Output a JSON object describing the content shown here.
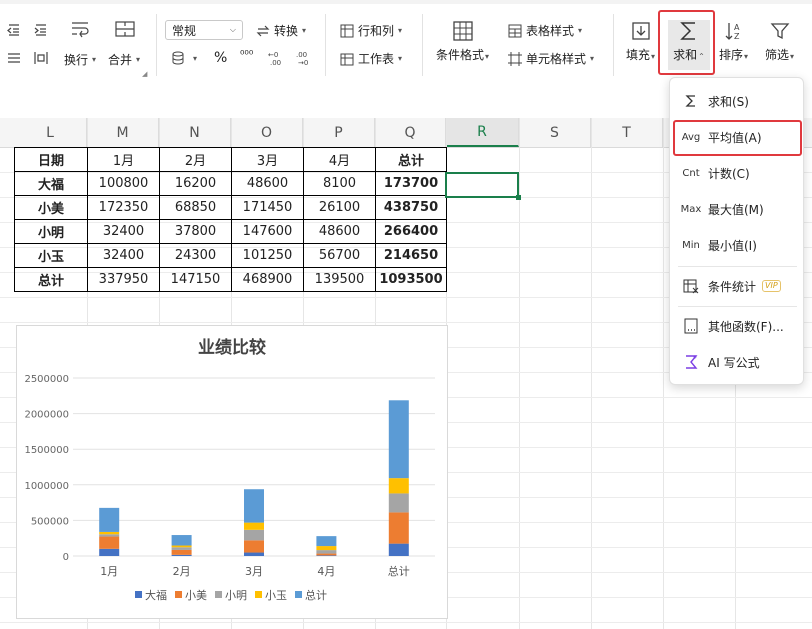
{
  "ribbon": {
    "wrap_label": "换行",
    "merge_label": "合并",
    "number_format": "常规",
    "convert_label": "转换",
    "percent_symbol": "%",
    "thousands_symbol": "⁰⁰⁰",
    "rows_cols_label": "行和列",
    "worksheet_label": "工作表",
    "cond_format_label": "条件格式",
    "table_style_label": "表格样式",
    "cell_style_label": "单元格样式",
    "fill_label": "填充",
    "sum_label": "求和",
    "sort_label": "排序",
    "filter_label": "筛选"
  },
  "columns": [
    "L",
    "M",
    "N",
    "O",
    "P",
    "Q",
    "R",
    "S",
    "T"
  ],
  "active_column": "R",
  "table": {
    "header": [
      "日期",
      "1月",
      "2月",
      "3月",
      "4月",
      "总计"
    ],
    "rows": [
      [
        "大福",
        "100800",
        "16200",
        "48600",
        "8100",
        "173700"
      ],
      [
        "小美",
        "172350",
        "68850",
        "171450",
        "26100",
        "438750"
      ],
      [
        "小明",
        "32400",
        "37800",
        "147600",
        "48600",
        "266400"
      ],
      [
        "小玉",
        "32400",
        "24300",
        "101250",
        "56700",
        "214650"
      ],
      [
        "总计",
        "337950",
        "147150",
        "468900",
        "139500",
        "1093500"
      ]
    ]
  },
  "sum_menu": {
    "items": [
      {
        "icon": "Σ",
        "label": "求和(S)"
      },
      {
        "icon": "Avg",
        "label": "平均值(A)"
      },
      {
        "icon": "Cnt",
        "label": "计数(C)"
      },
      {
        "icon": "Max",
        "label": "最大值(M)"
      },
      {
        "icon": "Min",
        "label": "最小值(I)"
      },
      {
        "icon": "cond-stat-icon",
        "label": "条件统计",
        "badge": "VIP"
      },
      {
        "icon": "other-func-icon",
        "label": "其他函数(F)..."
      },
      {
        "icon": "ai-formula-icon",
        "label": "AI 写公式"
      }
    ],
    "highlighted": "平均值(A)"
  },
  "colors": {
    "accent_green": "#1a7f4b",
    "highlight_red": "#e0393e"
  },
  "chart_data": {
    "type": "bar",
    "stacked": true,
    "title": "业绩比较",
    "categories": [
      "1月",
      "2月",
      "3月",
      "4月",
      "总计"
    ],
    "series": [
      {
        "name": "大福",
        "color": "#4472c4",
        "values": [
          100800,
          16200,
          48600,
          8100,
          173700
        ]
      },
      {
        "name": "小美",
        "color": "#ed7d31",
        "values": [
          172350,
          68850,
          171450,
          26100,
          438750
        ]
      },
      {
        "name": "小明",
        "color": "#a5a5a5",
        "values": [
          32400,
          37800,
          147600,
          48600,
          266400
        ]
      },
      {
        "name": "小玉",
        "color": "#ffc000",
        "values": [
          32400,
          24300,
          101250,
          56700,
          214650
        ]
      },
      {
        "name": "总计",
        "color": "#5b9bd5",
        "values": [
          337950,
          147150,
          468900,
          139500,
          1093500
        ]
      }
    ],
    "yticks": [
      "2500000",
      "2000000",
      "1500000",
      "1000000",
      "500000",
      "0"
    ],
    "ylim": [
      0,
      2500000
    ],
    "legend": "bottom",
    "grid": true
  }
}
